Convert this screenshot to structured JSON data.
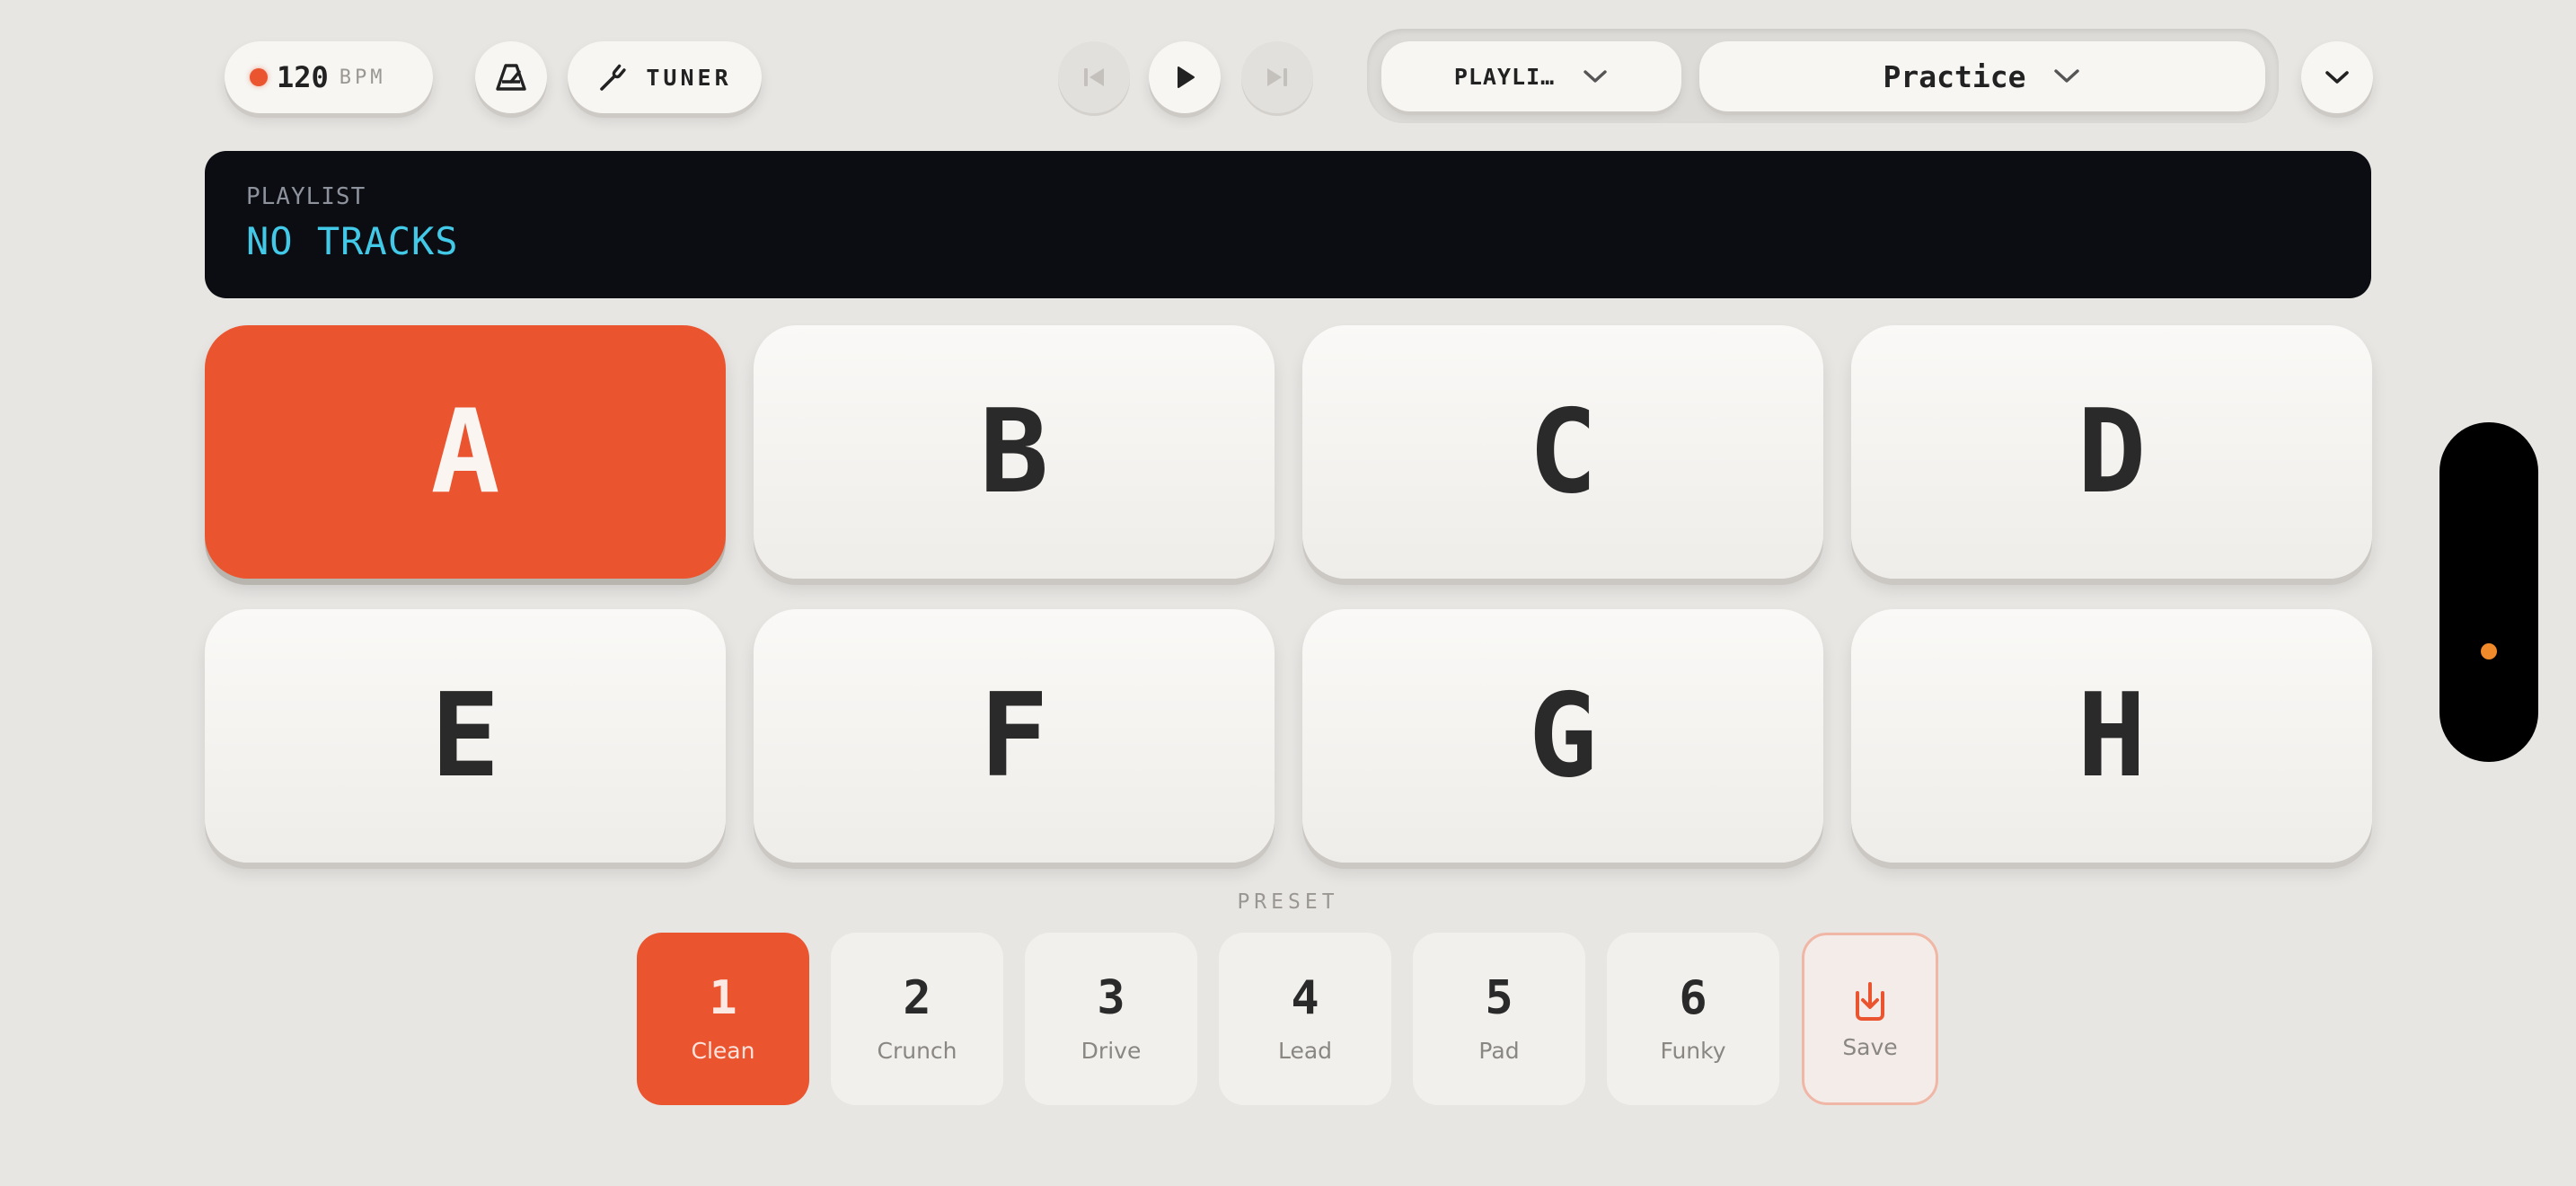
{
  "toolbar": {
    "bpm_value": "120",
    "bpm_unit": "BPM",
    "metronome_icon": "metronome-icon",
    "tuner_label": "TUNER",
    "playlist_selector": "PLAYLI…",
    "mode_selector": "Practice"
  },
  "transport": {
    "prev_icon": "skip-previous-icon",
    "play_icon": "play-icon",
    "next_icon": "skip-next-icon"
  },
  "display": {
    "label": "PLAYLIST",
    "value": "NO TRACKS"
  },
  "pads": [
    {
      "label": "A",
      "active": true
    },
    {
      "label": "B",
      "active": false
    },
    {
      "label": "C",
      "active": false
    },
    {
      "label": "D",
      "active": false
    },
    {
      "label": "E",
      "active": false
    },
    {
      "label": "F",
      "active": false
    },
    {
      "label": "G",
      "active": false
    },
    {
      "label": "H",
      "active": false
    }
  ],
  "preset": {
    "section_label": "PRESET",
    "items": [
      {
        "number": "1",
        "name": "Clean",
        "active": true
      },
      {
        "number": "2",
        "name": "Crunch",
        "active": false
      },
      {
        "number": "3",
        "name": "Drive",
        "active": false
      },
      {
        "number": "4",
        "name": "Lead",
        "active": false
      },
      {
        "number": "5",
        "name": "Pad",
        "active": false
      },
      {
        "number": "6",
        "name": "Funky",
        "active": false
      }
    ],
    "save_label": "Save"
  },
  "colors": {
    "accent": "#ea5530",
    "display_bg": "#0b0d12",
    "display_text": "#43c9e8",
    "background": "#e8e6e3"
  }
}
